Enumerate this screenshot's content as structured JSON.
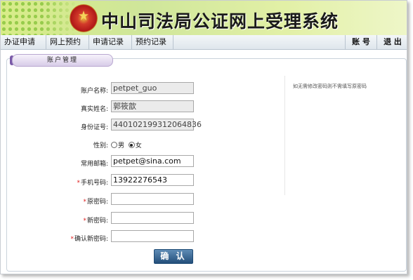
{
  "header": {
    "title": "中山司法局公证网上受理系统",
    "emblem_icon": "court-emblem-icon",
    "colors": {
      "banner": "#d8ec88",
      "accent": "#7a5aa8"
    }
  },
  "nav": {
    "items": [
      "办证申请",
      "网上预约",
      "申请记录",
      "预约记录"
    ],
    "account": "账 号",
    "logout": "退 出"
  },
  "section": {
    "title": "账户管理"
  },
  "form": {
    "account_name": {
      "label": "账户名称:",
      "value": "petpet_guo"
    },
    "real_name": {
      "label": "真实姓名:",
      "value": "郭筱歆"
    },
    "id_number": {
      "label": "身份证号:",
      "value": "440102199312064836"
    },
    "gender": {
      "label": "性别:",
      "options": [
        "男",
        "女"
      ],
      "selected": "女"
    },
    "email": {
      "label": "常用邮箱:",
      "value": "petpet@sina.com"
    },
    "phone": {
      "label": "手机号码:",
      "value": "13922276543",
      "required_mark": "*"
    },
    "old_password": {
      "label": "原密码:",
      "value": "",
      "required_mark": "*"
    },
    "new_password": {
      "label": "新密码:",
      "value": "",
      "required_mark": "*"
    },
    "confirm_password": {
      "label": "确认新密码:",
      "value": "",
      "required_mark": "*"
    },
    "submit": "确 认"
  },
  "hint": "如无需修改密码则不需填写原密码"
}
